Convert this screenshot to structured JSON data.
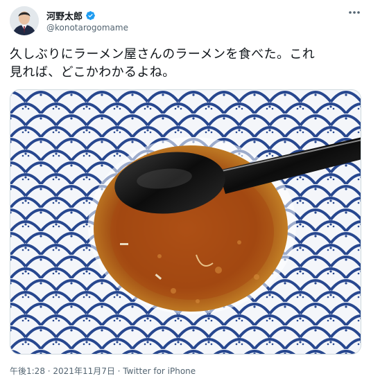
{
  "author": {
    "display_name": "河野太郎",
    "handle": "@konotarogomame",
    "verified": true,
    "avatar_icon": "person-avatar-icon"
  },
  "tweet": {
    "text": "久しぶりにラーメン屋さんのラーメンを食べた。これ\n見れば、どこかわかるよね。",
    "image": "ramen-bowl-photo",
    "time": "午後1:28",
    "separator": " · ",
    "date": "2021年11月7日",
    "separator2": " · ",
    "source": "Twitter for iPhone"
  },
  "colors": {
    "text": "#0f1419",
    "secondary": "#536471",
    "verified": "#1d9bf0",
    "border": "#cfd9de"
  }
}
